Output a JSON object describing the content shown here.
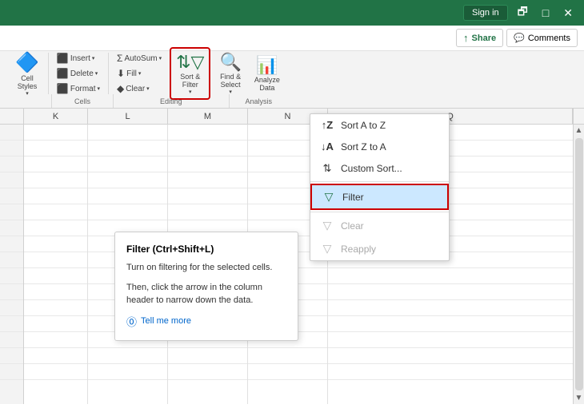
{
  "titlebar": {
    "signin_label": "Sign in",
    "icons": [
      "restore",
      "maximize",
      "close"
    ]
  },
  "sharebar": {
    "share_label": "Share",
    "comments_label": "Comments"
  },
  "ribbon": {
    "groups": [
      {
        "name": "cell-styles",
        "buttons": [
          {
            "id": "cell-styles",
            "icon": "🟥",
            "label": "Cell\nStyles"
          }
        ],
        "label": ""
      },
      {
        "name": "cells",
        "buttons": [
          {
            "id": "insert",
            "label": "Insert"
          },
          {
            "id": "delete",
            "label": "Delete"
          },
          {
            "id": "format",
            "label": "Format"
          }
        ],
        "label": "Cells"
      },
      {
        "name": "editing",
        "autosum_label": "AutoSum",
        "fill_label": "Fill",
        "clear_label": "Clear",
        "sort_filter_label": "Sort &\nFilter",
        "find_select_label": "Find &\nSelect",
        "analyze_label": "Analyze\nData",
        "label": "Editing"
      }
    ],
    "analysis_label": "Analysis"
  },
  "columns": [
    "K",
    "L",
    "M",
    "N",
    "Q"
  ],
  "dropdown": {
    "items": [
      {
        "id": "sort-a-z",
        "icon": "↑Z",
        "label": "Sort A to Z",
        "disabled": false
      },
      {
        "id": "sort-z-a",
        "icon": "↓A",
        "label": "Sort Z to A",
        "disabled": false
      },
      {
        "id": "custom-sort",
        "icon": "⇅",
        "label": "Custom Sort...",
        "disabled": false
      },
      {
        "id": "filter",
        "icon": "▽",
        "label": "Filter",
        "disabled": false,
        "highlighted": true
      },
      {
        "id": "clear",
        "icon": "▽",
        "label": "Clear",
        "disabled": true
      },
      {
        "id": "reapply",
        "icon": "▽",
        "label": "Reapply",
        "disabled": true
      }
    ]
  },
  "tooltip": {
    "title": "Filter (Ctrl+Shift+L)",
    "desc1": "Turn on filtering for the selected cells.",
    "desc2": "Then, click the arrow in the column header to narrow down the data.",
    "link_label": "Tell me more",
    "link_icon": "?"
  }
}
